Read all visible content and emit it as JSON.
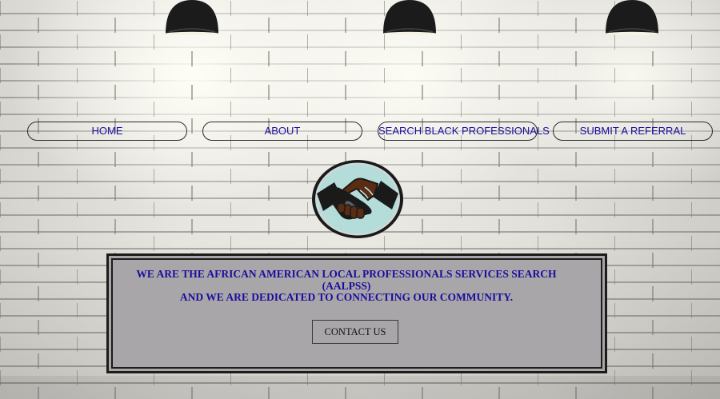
{
  "nav": {
    "items": [
      {
        "label": "HOME"
      },
      {
        "label": "ABOUT"
      },
      {
        "label": "SEARCH BLACK PROFESSIONALS"
      },
      {
        "label": "SUBMIT A REFERRAL"
      }
    ]
  },
  "logo": {
    "icon": "handshake-icon",
    "colors": {
      "background": "#b4dcd9",
      "ring": "#1a1a1a",
      "hand_dark": "#5a2c14",
      "hand_light": "#c9e6e4"
    }
  },
  "hero": {
    "line1": "WE ARE THE AFRICAN AMERICAN LOCAL PROFESSIONALS SERVICES SEARCH",
    "line2": "(AALPSS)",
    "line3": "AND WE ARE DEDICATED TO CONNECTING OUR COMMUNITY.",
    "contact_label": "CONTACT US"
  },
  "colors": {
    "link": "#1a0d9e",
    "panel": "#a8a6a8",
    "border": "#1c1c1c"
  }
}
